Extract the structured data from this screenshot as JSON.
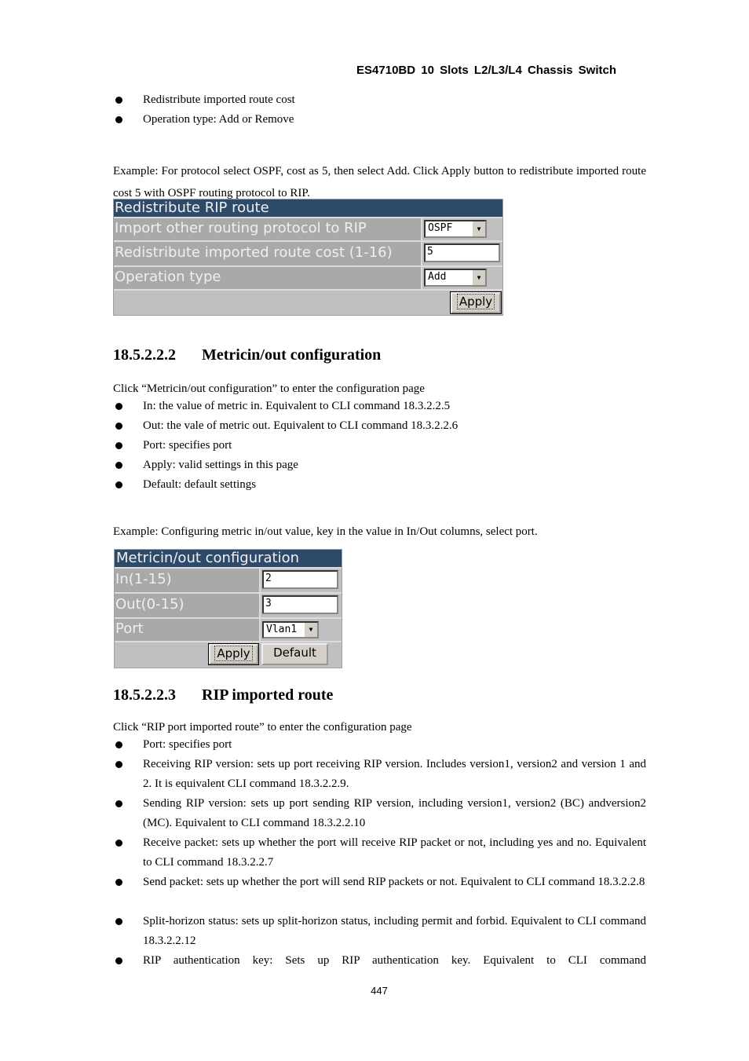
{
  "header": {
    "title": "ES4710BD 10 Slots L2/L3/L4 Chassis Switch"
  },
  "intro_bullets": [
    "Redistribute imported route cost",
    "Operation type: Add or Remove"
  ],
  "example1": "Example: For protocol select OSPF, cost as 5, then select Add. Click Apply button to redistribute imported route cost 5 with OSPF routing protocol to RIP.",
  "form_redistribute": {
    "title": "Redistribute RIP route",
    "rows": [
      {
        "label": "Import other routing protocol to RIP",
        "type": "select",
        "value": "OSPF"
      },
      {
        "label": "Redistribute imported route cost (1-16)",
        "type": "text",
        "value": "5"
      },
      {
        "label": "Operation type",
        "type": "select",
        "value": "Add"
      }
    ],
    "apply_label": "Apply"
  },
  "section2": {
    "number": "18.5.2.2.2",
    "title": "Metricin/out configuration",
    "intro": "Click “Metricin/out configuration” to enter the configuration page",
    "bullets": [
      "In: the value of metric in. Equivalent to CLI command 18.3.2.2.5",
      "Out: the vale of metric out. Equivalent to CLI command 18.3.2.2.6",
      "Port: specifies port",
      "Apply: valid settings in this page",
      "Default: default settings"
    ],
    "example": "Example: Configuring metric in/out value, key in the value in In/Out columns, select port."
  },
  "form_metric": {
    "title": "Metricin/out configuration",
    "rows": [
      {
        "label": "In(1-15)",
        "type": "text",
        "value": "2"
      },
      {
        "label": "Out(0-15)",
        "type": "text",
        "value": "3"
      },
      {
        "label": "Port",
        "type": "select",
        "value": "Vlan1"
      }
    ],
    "apply_label": "Apply",
    "default_label": "Default"
  },
  "section3": {
    "number": "18.5.2.2.3",
    "title": "RIP imported route",
    "intro": "Click “RIP port imported route” to enter the configuration page",
    "bullets": [
      "Port: specifies port",
      "Receiving RIP version: sets up port receiving RIP version. Includes version1, version2 and version 1 and 2. It is equivalent CLI command 18.3.2.2.9.",
      "Sending RIP version: sets up port sending RIP version, including version1, version2 (BC) andversion2 (MC). Equivalent to CLI command 18.3.2.2.10",
      "Receive packet: sets up whether the port will receive RIP packet or not, including yes and no. Equivalent to CLI command 18.3.2.2.7",
      "Send packet: sets up whether the port will send RIP packets or not. Equivalent to CLI command 18.3.2.2.8",
      "Split-horizon status: sets up split-horizon status, including permit and forbid. Equivalent to CLI command 18.3.2.2.12",
      "RIP authentication key: Sets up RIP authentication key. Equivalent to CLI command"
    ]
  },
  "footer": {
    "page_number": "447"
  }
}
